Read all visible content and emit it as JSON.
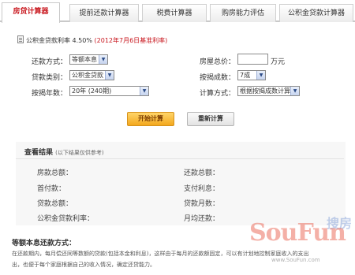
{
  "tabs": [
    {
      "label": "房贷计算器",
      "active": true
    },
    {
      "label": "提前还款计算器",
      "active": false
    },
    {
      "label": "税费计算器",
      "active": false
    },
    {
      "label": "购房能力评估",
      "active": false
    },
    {
      "label": "公积金贷款计算器",
      "active": false
    }
  ],
  "rate": {
    "text": "公积金贷款利率 4.50%",
    "note": "(2012年7月6日基准利率)"
  },
  "form": {
    "repayment_method_label": "还款方式：",
    "repayment_method_value": "等额本息",
    "loan_type_label": "贷款类别：",
    "loan_type_value": "公积金贷款",
    "loan_years_label": "按揭年数：",
    "loan_years_value": "20年 (240期)",
    "total_price_label": "房屋总价：",
    "total_price_value": "",
    "total_price_unit": "万元",
    "mortgage_ratio_label": "按揭成数：",
    "mortgage_ratio_value": "7成",
    "calc_method_label": "计算方式：",
    "calc_method_value": "根据按揭成数计算"
  },
  "buttons": {
    "start": "开始计算",
    "reset": "重新计算"
  },
  "results": {
    "title": "查看结果",
    "note": "(以下结果仅供参考)",
    "left": [
      "房款总额：",
      "首付款：",
      "贷款总额：",
      "公积金贷款利率："
    ],
    "right": [
      "还款总额：",
      "支付利息：",
      "贷款月数：",
      "月均还款："
    ]
  },
  "description": {
    "title": "等额本息还款方式：",
    "line1": "在还款期内，每月偿还同等数额的贷款(包括本金和利息)，这样由于每月的还款额固定，可以有计划地控制家庭收入的支出",
    "line2": "出，也便于每个家庭根据自己的收入情况，确定还贷能力。"
  },
  "watermark": {
    "logo": "SouFun",
    "chinese": "搜房",
    "url": "www.SouFun.com"
  },
  "icons": {
    "rate_doc": "document-icon",
    "dropdown": "chevron-down-icon"
  },
  "colors": {
    "active_tab": "#c8161d",
    "start_button": "#f3a81e",
    "rate_note": "#c8161d"
  }
}
